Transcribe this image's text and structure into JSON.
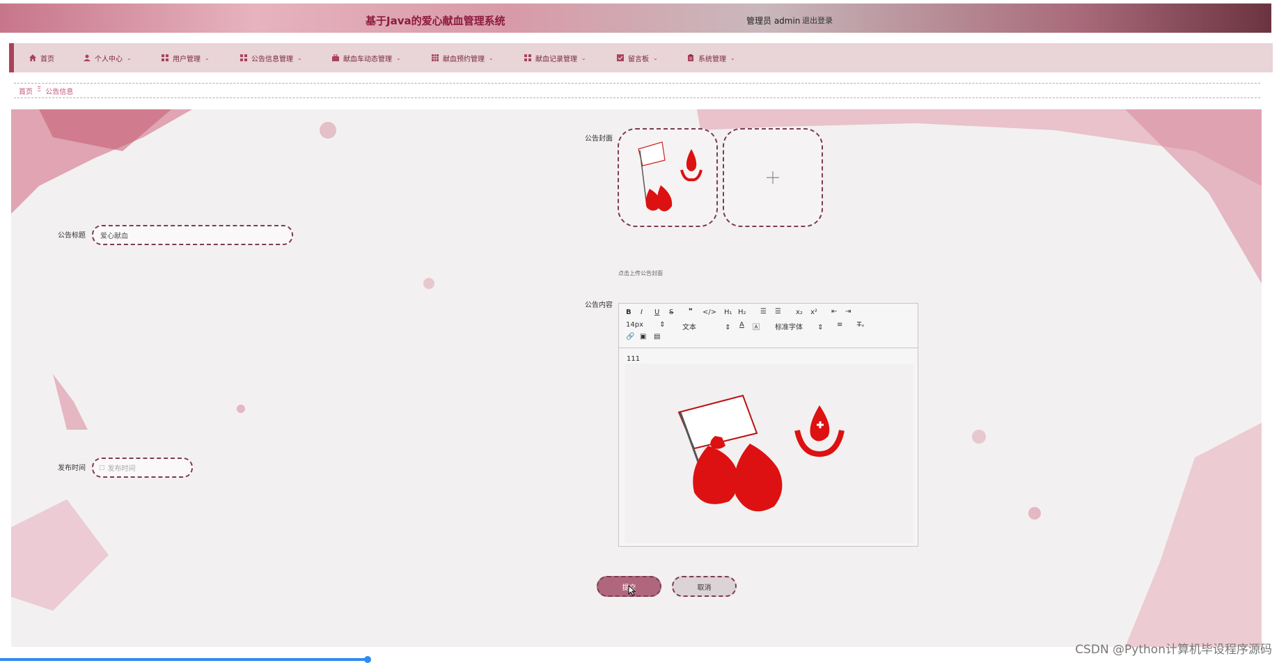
{
  "header": {
    "title": "基于Java的爱心献血管理系统",
    "user": "管理员 admin",
    "logout": "退出登录"
  },
  "nav": {
    "items": [
      {
        "label": "首页",
        "icon": "home-icon",
        "caret": false
      },
      {
        "label": "个人中心",
        "icon": "user-icon",
        "caret": true
      },
      {
        "label": "用户管理",
        "icon": "grid-icon",
        "caret": true
      },
      {
        "label": "公告信息管理",
        "icon": "grid-icon",
        "caret": true
      },
      {
        "label": "献血车动态管理",
        "icon": "bag-icon",
        "caret": true
      },
      {
        "label": "献血预约管理",
        "icon": "table-icon",
        "caret": true
      },
      {
        "label": "献血记录管理",
        "icon": "grid-icon",
        "caret": true
      },
      {
        "label": "留言板",
        "icon": "check-icon",
        "caret": true
      },
      {
        "label": "系统管理",
        "icon": "clipboard-icon",
        "caret": true
      }
    ]
  },
  "breadcrumb": {
    "home": "首页",
    "separator": "Ξ",
    "current": "公告信息"
  },
  "form": {
    "title_label": "公告标题",
    "title_value": "爱心献血",
    "cover_label": "公告封面",
    "cover_hint": "点击上传公告封面",
    "content_label": "公告内容",
    "content_text": "111",
    "publish_label": "发布时间",
    "publish_placeholder": "发布时间",
    "submit": "提交",
    "cancel": "取消"
  },
  "editor": {
    "font_size": "14px",
    "paragraph": "文本",
    "font_family": "标准字体"
  },
  "watermark": "CSDN @Python计算机毕设程序源码",
  "colors": {
    "accent": "#a8435c",
    "title": "#8c1a3d",
    "nav_bg": "#e9d4d8"
  }
}
